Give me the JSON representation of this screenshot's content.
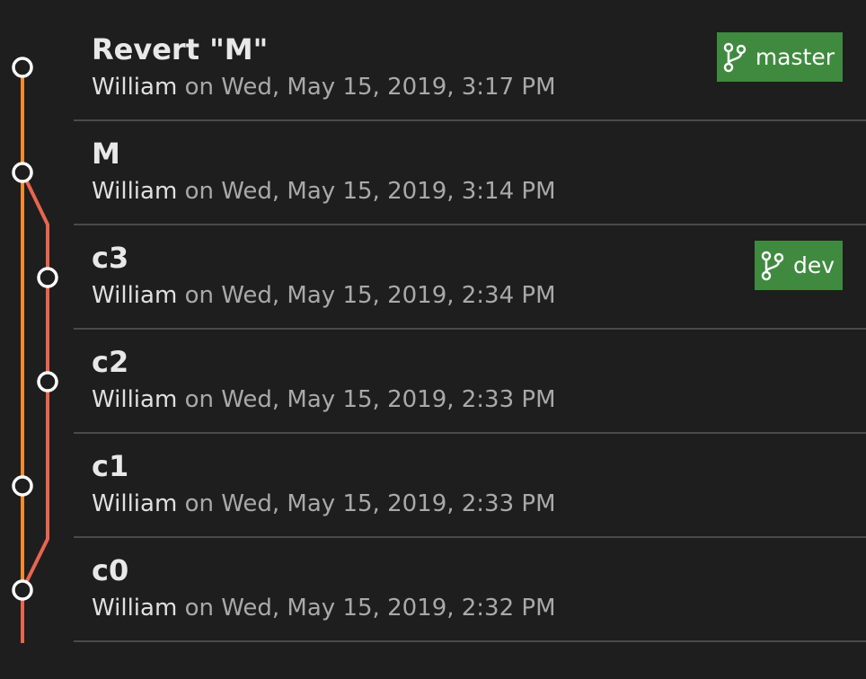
{
  "colors": {
    "background": "#1e1e1e",
    "master_line": "#f28a2e",
    "dev_line": "#e8654f",
    "badge": "#3f8a3f",
    "divider": "#4a4a4a"
  },
  "commits": [
    {
      "title": "Revert \"M\"",
      "author": "William",
      "on": "on",
      "date": "Wed, May 15, 2019, 3:17 PM",
      "branch": "master"
    },
    {
      "title": "M",
      "author": "William",
      "on": "on",
      "date": "Wed, May 15, 2019, 3:14 PM",
      "branch": ""
    },
    {
      "title": "c3",
      "author": "William",
      "on": "on",
      "date": "Wed, May 15, 2019, 2:34 PM",
      "branch": "dev"
    },
    {
      "title": "c2",
      "author": "William",
      "on": "on",
      "date": "Wed, May 15, 2019, 2:33 PM",
      "branch": ""
    },
    {
      "title": "c1",
      "author": "William",
      "on": "on",
      "date": "Wed, May 15, 2019, 2:33 PM",
      "branch": ""
    },
    {
      "title": "c0",
      "author": "William",
      "on": "on",
      "date": "Wed, May 15, 2019, 2:32 PM",
      "branch": ""
    }
  ],
  "icons": {
    "branch": "git-branch-icon",
    "commit": "commit-node-icon"
  }
}
